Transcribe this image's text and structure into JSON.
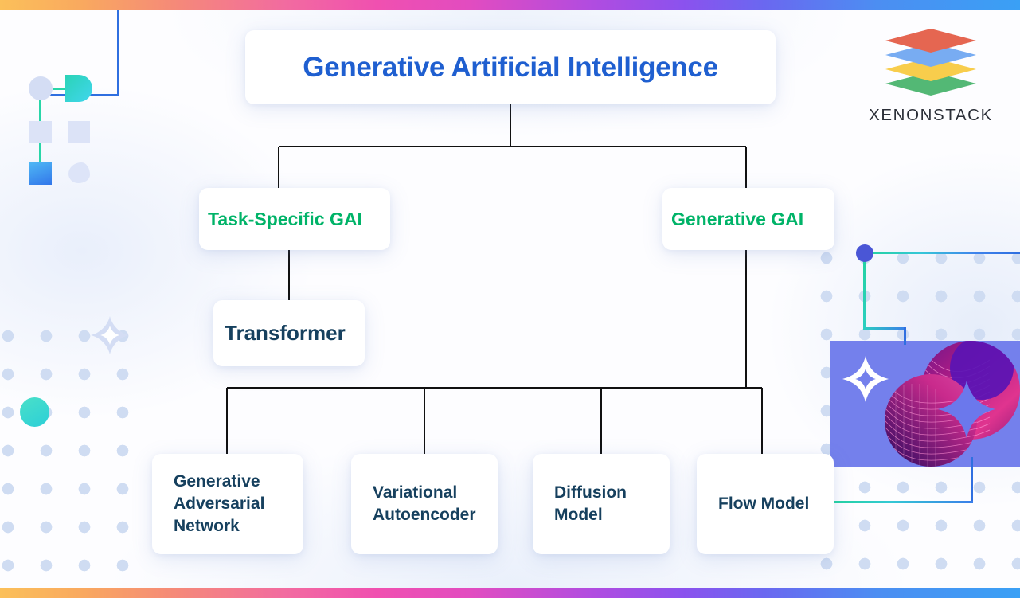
{
  "brand": {
    "name": "XENONSTACK",
    "logo_icon": "stacked-layers-icon",
    "logo_layer_colors": [
      "#e0452c",
      "#5b9bf0",
      "#f7c325",
      "#2eaa57"
    ]
  },
  "diagram": {
    "type": "tree",
    "root": {
      "id": "root",
      "label": "Generative Artificial Intelligence",
      "color": "#1f5fd0"
    },
    "level2": [
      {
        "id": "task-specific-gai",
        "label": "Task-Specific GAI",
        "color": "#00b368"
      },
      {
        "id": "generative-gai",
        "label": "Generative GAI",
        "color": "#00b368"
      }
    ],
    "level3": [
      {
        "id": "transformer",
        "label": "Transformer",
        "color": "#16405e",
        "parent": "task-specific-gai"
      },
      {
        "id": "generative-adversarial-network",
        "label": "Generative Adversarial Network",
        "color": "#16405e",
        "parent": "generative-gai"
      },
      {
        "id": "variational-autoencoder",
        "label": "Variational Autoencoder",
        "color": "#16405e",
        "parent": "generative-gai"
      },
      {
        "id": "diffusion-model",
        "label": "Diffusion Model",
        "color": "#16405e",
        "parent": "generative-gai"
      },
      {
        "id": "flow-model",
        "label": "Flow Model",
        "color": "#16405e",
        "parent": "generative-gai"
      }
    ],
    "connector_color": "#111111"
  },
  "decor": {
    "accent_gradient": [
      "#fbc05a",
      "#f26ba0",
      "#8b52ee",
      "#3aa0f5"
    ],
    "teal": "#29d6a8",
    "blue_line": "#2f6fe0",
    "dot_color": "#cfdcf2",
    "panel_color": "#7480ec",
    "sparkle_icon": "four-point-sparkle-icon"
  }
}
